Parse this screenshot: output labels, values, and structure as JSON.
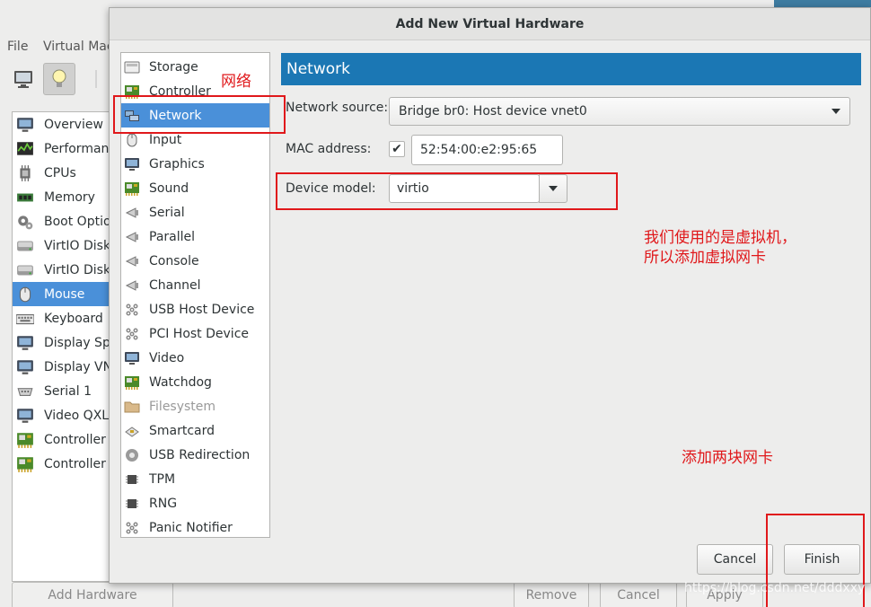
{
  "background": {
    "menu": [
      "File",
      "Virtual Mac"
    ],
    "devices": [
      {
        "label": "Overview",
        "icon": "monitor-icon"
      },
      {
        "label": "Performanc",
        "icon": "performance-icon"
      },
      {
        "label": "CPUs",
        "icon": "cpu-icon"
      },
      {
        "label": "Memory",
        "icon": "memory-icon"
      },
      {
        "label": "Boot Optio",
        "icon": "gears-icon"
      },
      {
        "label": "VirtIO Disk",
        "icon": "disk-icon"
      },
      {
        "label": "VirtIO Disk",
        "icon": "disk-icon"
      },
      {
        "label": "Mouse",
        "icon": "mouse-icon"
      },
      {
        "label": "Keyboard",
        "icon": "keyboard-icon"
      },
      {
        "label": "Display Spi",
        "icon": "display-icon"
      },
      {
        "label": "Display VN",
        "icon": "display-icon"
      },
      {
        "label": "Serial 1",
        "icon": "serial-icon"
      },
      {
        "label": "Video QXL",
        "icon": "display-icon"
      },
      {
        "label": "Controller U",
        "icon": "card-icon"
      },
      {
        "label": "Controller P",
        "icon": "card-icon"
      }
    ],
    "selected_device": "Mouse",
    "add_hardware": "Add Hardware",
    "remove": "Remove",
    "cancel": "Cancel",
    "apply": "Apply"
  },
  "dialog": {
    "title": "Add New Virtual Hardware",
    "hardware_list": [
      {
        "label": "Storage",
        "icon": "storage-icon"
      },
      {
        "label": "Controller",
        "icon": "card-icon"
      },
      {
        "label": "Network",
        "icon": "network-icon"
      },
      {
        "label": "Input",
        "icon": "mouse-icon"
      },
      {
        "label": "Graphics",
        "icon": "monitor-icon"
      },
      {
        "label": "Sound",
        "icon": "card-icon"
      },
      {
        "label": "Serial",
        "icon": "port-icon"
      },
      {
        "label": "Parallel",
        "icon": "port-icon"
      },
      {
        "label": "Console",
        "icon": "port-icon"
      },
      {
        "label": "Channel",
        "icon": "port-icon"
      },
      {
        "label": "USB Host Device",
        "icon": "usb-icon"
      },
      {
        "label": "PCI Host Device",
        "icon": "usb-icon"
      },
      {
        "label": "Video",
        "icon": "monitor-icon"
      },
      {
        "label": "Watchdog",
        "icon": "card-icon"
      },
      {
        "label": "Filesystem",
        "icon": "folder-icon"
      },
      {
        "label": "Smartcard",
        "icon": "smartcard-icon"
      },
      {
        "label": "USB Redirection",
        "icon": "usb-redirect-icon"
      },
      {
        "label": "TPM",
        "icon": "chip-icon"
      },
      {
        "label": "RNG",
        "icon": "chip-icon"
      },
      {
        "label": "Panic Notifier",
        "icon": "usb-icon"
      }
    ],
    "selected": "Network",
    "disabled": [
      "Filesystem"
    ],
    "panel_title": "Network",
    "network_source_label": "Network source:",
    "network_source_value": "Bridge br0: Host device vnet0",
    "mac_label": "MAC address:",
    "mac_checked": true,
    "mac_value": "52:54:00:e2:95:65",
    "device_model_label": "Device model:",
    "device_model_value": "virtio",
    "cancel": "Cancel",
    "finish": "Finish"
  },
  "annotations": {
    "network_note": "网络",
    "vm_note_line1": "我们使用的是虚拟机，",
    "vm_note_line2": "所以添加虚拟网卡",
    "add_two_note": "添加两块网卡",
    "color": "#e0181b"
  },
  "watermark": "https://blog.csdn.net/dddxxy"
}
